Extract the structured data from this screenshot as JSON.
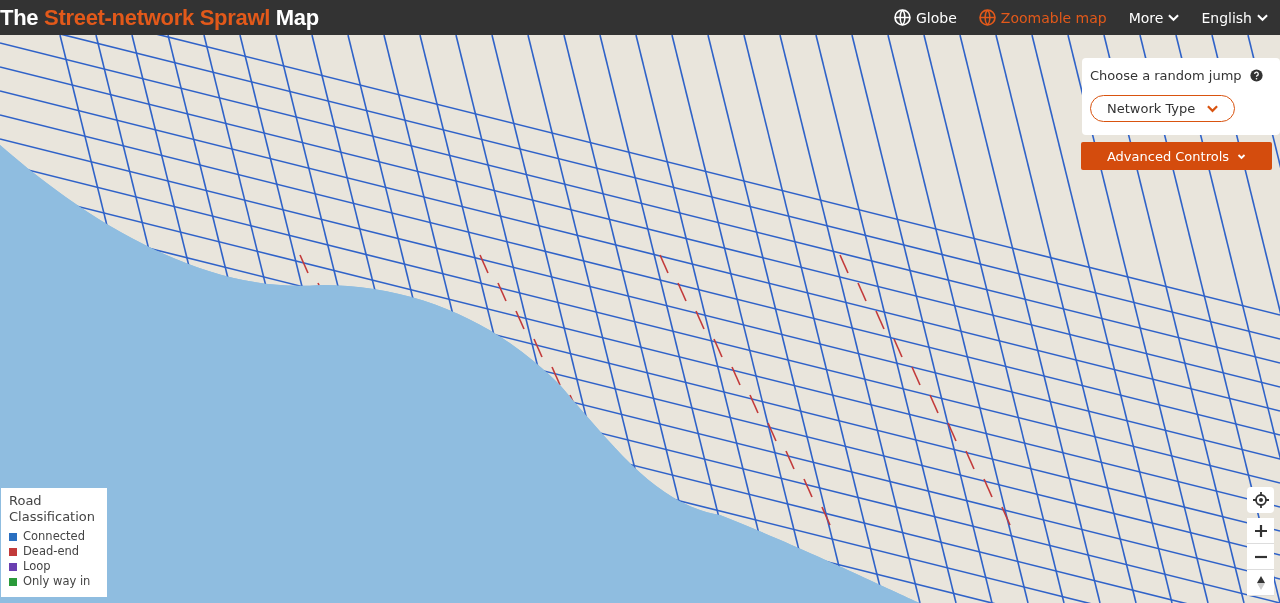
{
  "header": {
    "title": {
      "prefix": "The",
      "highlight": "Street-network Sprawl",
      "suffix": "Map"
    },
    "nav": [
      {
        "kind": "globe",
        "label": "Globe",
        "selected": false
      },
      {
        "kind": "globe",
        "label": "Zoomable map",
        "selected": true
      },
      {
        "kind": "menu",
        "label": "More",
        "selected": false
      },
      {
        "kind": "menu",
        "label": "English",
        "selected": false
      }
    ]
  },
  "jump_panel": {
    "title": "Choose a random jump",
    "dropdown": "Network Type",
    "advanced_button": "Advanced Controls"
  },
  "legend": {
    "title": "Road Classification",
    "items": [
      {
        "label": "Connected",
        "color": "#2a6fc0"
      },
      {
        "label": "Dead-end",
        "color": "#c23a3a"
      },
      {
        "label": "Loop",
        "color": "#6a3fb0"
      },
      {
        "label": "Only way in",
        "color": "#2a9a3a"
      }
    ]
  }
}
